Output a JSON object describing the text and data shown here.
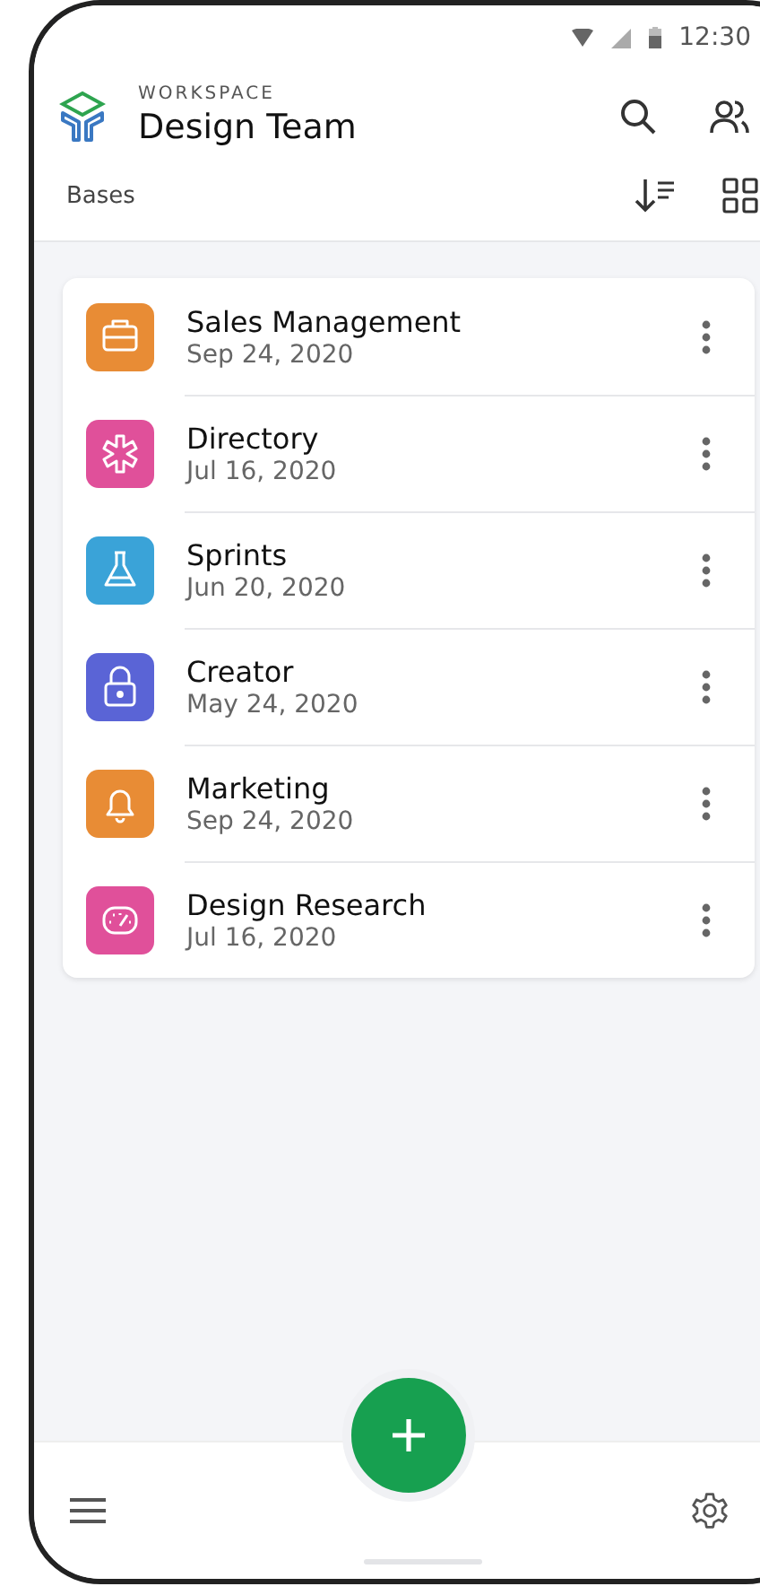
{
  "status_bar": {
    "time": "12:30"
  },
  "header": {
    "overline": "WORKSPACE",
    "title": "Design Team"
  },
  "section": {
    "label": "Bases"
  },
  "bases": [
    {
      "name": "Sales Management",
      "date": "Sep 24, 2020",
      "kind": "briefcase",
      "color": "#e88c35"
    },
    {
      "name": "Directory",
      "date": "Jul 16, 2020",
      "kind": "asterisk",
      "color": "#e0509a"
    },
    {
      "name": "Sprints",
      "date": "Jun 20, 2020",
      "kind": "flask",
      "color": "#3aa3d8"
    },
    {
      "name": "Creator",
      "date": "May 24, 2020",
      "kind": "lock",
      "color": "#5a64d6"
    },
    {
      "name": "Marketing",
      "date": "Sep 24, 2020",
      "kind": "bell",
      "color": "#e88c35"
    },
    {
      "name": "Design Research",
      "date": "Jul 16, 2020",
      "kind": "gauge",
      "color": "#e0509a"
    }
  ]
}
